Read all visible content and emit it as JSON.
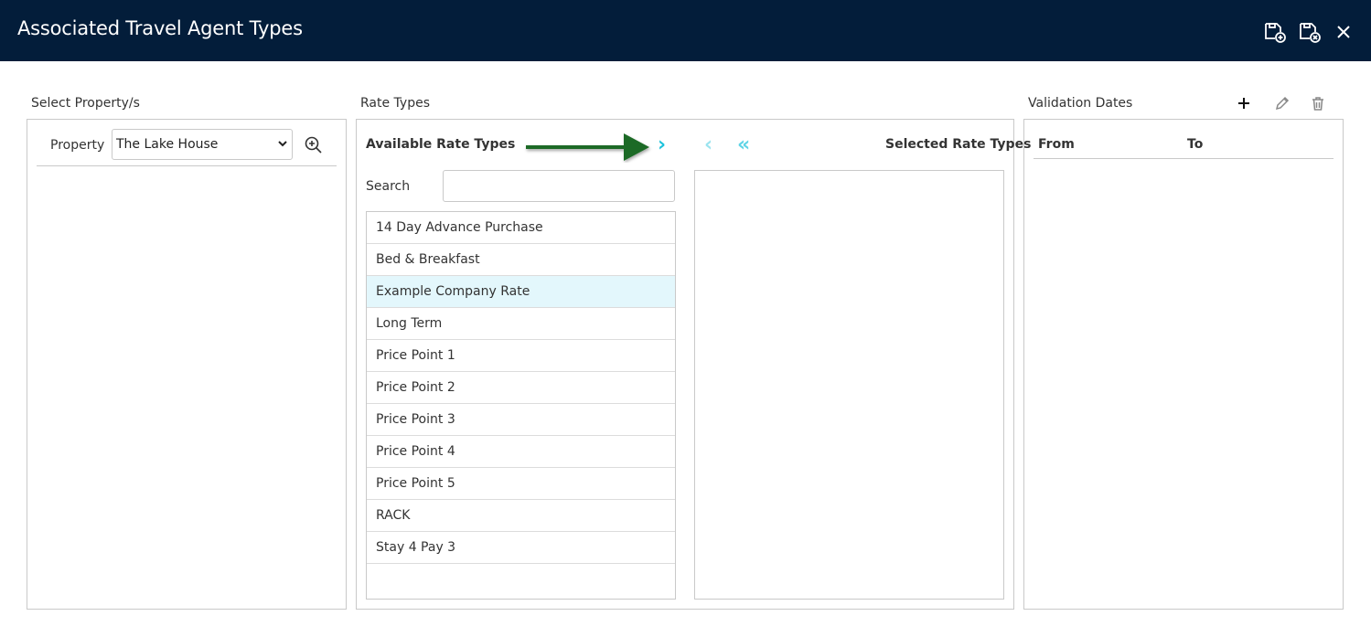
{
  "window": {
    "title": "Associated Travel Agent Types",
    "icons": [
      "save-and-new-icon",
      "save-and-close-icon",
      "close-icon"
    ]
  },
  "property_section": {
    "label": "Select Property/s",
    "field_label": "Property",
    "selected_property": "The Lake House"
  },
  "rate_types_section": {
    "label": "Rate Types",
    "available_title": "Available Rate Types",
    "selected_title": "Selected Rate Types",
    "search_label": "Search",
    "search_value": "",
    "available_items": [
      "14 Day Advance Purchase",
      "Bed & Breakfast",
      "Example Company Rate",
      "Long Term",
      "Price Point 1",
      "Price Point 2",
      "Price Point 3",
      "Price Point 4",
      "Price Point 5",
      "RACK",
      "Stay 4 Pay 3"
    ],
    "selected_index": 2,
    "selected_items": [],
    "move_right_glyph": "›",
    "move_left_glyph": "‹",
    "move_all_left_glyph": "«"
  },
  "validation_section": {
    "label": "Validation Dates",
    "columns": [
      "From",
      "To"
    ]
  },
  "colors": {
    "titlebar": "#031d3a",
    "accent_cyan": "#1fc3dc",
    "annotation_arrow": "#1e6b27",
    "selected_row": "#e3f7fc"
  }
}
